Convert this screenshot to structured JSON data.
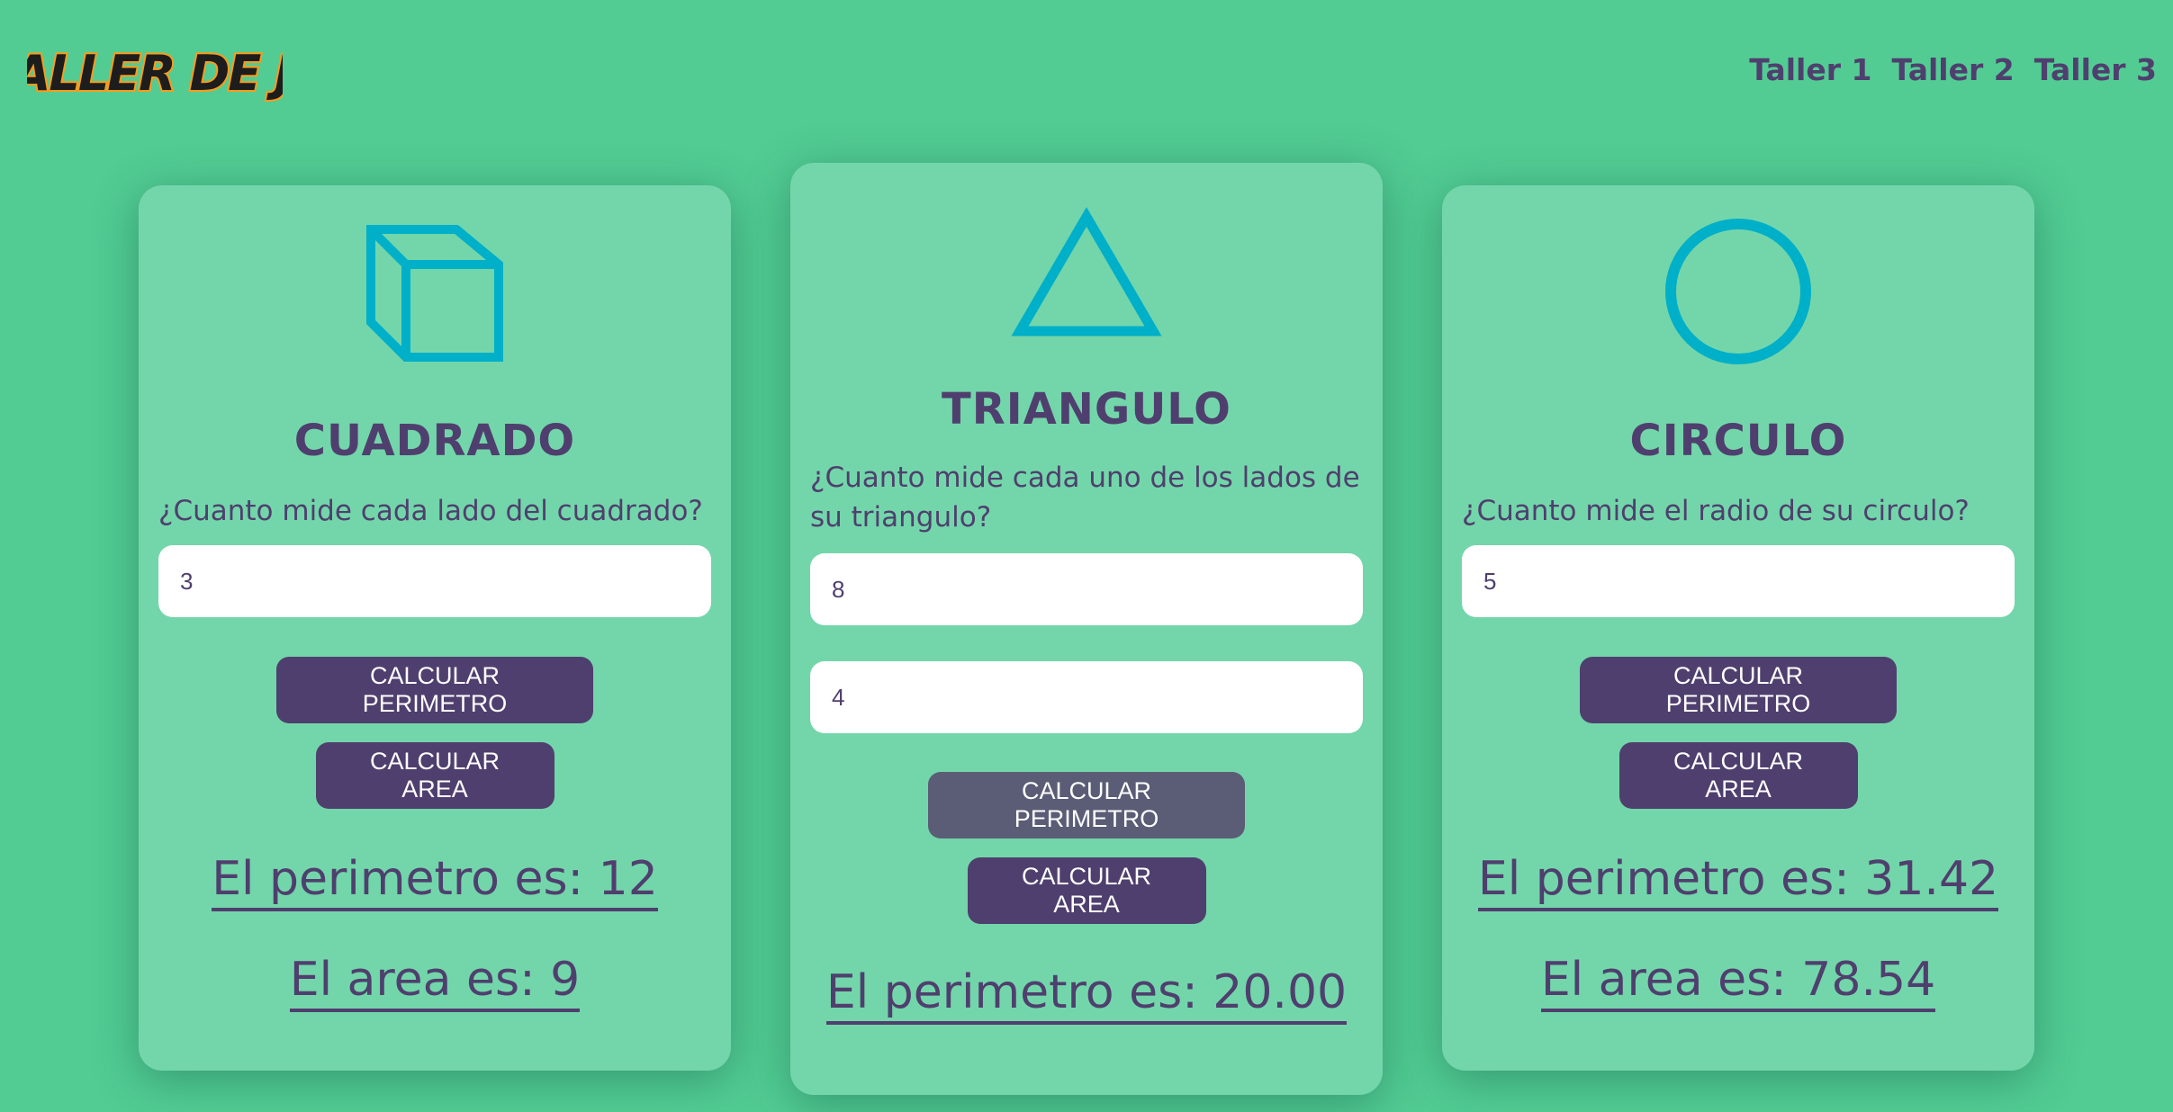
{
  "header": {
    "logo_text": "TALLER DE JS",
    "nav": [
      "Taller 1",
      "Taller 2",
      "Taller 3"
    ]
  },
  "colors": {
    "background": "#52cc93",
    "card": "#73d6aa",
    "accent": "#4f3f6e",
    "shape": "#00afc8",
    "logo_outline": "#ff9a19"
  },
  "cards": {
    "square": {
      "icon": "cube-icon",
      "title": "CUADRADO",
      "question": "¿Cuanto mide cada lado del cuadrado?",
      "side_value": "3",
      "perimeter_button": "CALCULAR PERIMETRO",
      "area_button": "CALCULAR AREA",
      "perimeter_result": "El perimetro es: 12",
      "area_result": "El area es: 9"
    },
    "triangle": {
      "icon": "triangle-icon",
      "title": "TRIANGULO",
      "question": "¿Cuanto mide cada uno de los lados de su triangulo?",
      "side_value": "8",
      "base_value": "4",
      "perimeter_button": "CALCULAR PERIMETRO",
      "area_button": "CALCULAR AREA",
      "perimeter_result": "El perimetro es: 20.00"
    },
    "circle": {
      "icon": "circle-icon",
      "title": "CIRCULO",
      "question": "¿Cuanto mide el radio de su circulo?",
      "radius_value": "5",
      "perimeter_button": "CALCULAR PERIMETRO",
      "area_button": "CALCULAR AREA",
      "perimeter_result": "El perimetro es: 31.42",
      "area_result": "El area es: 78.54"
    }
  }
}
